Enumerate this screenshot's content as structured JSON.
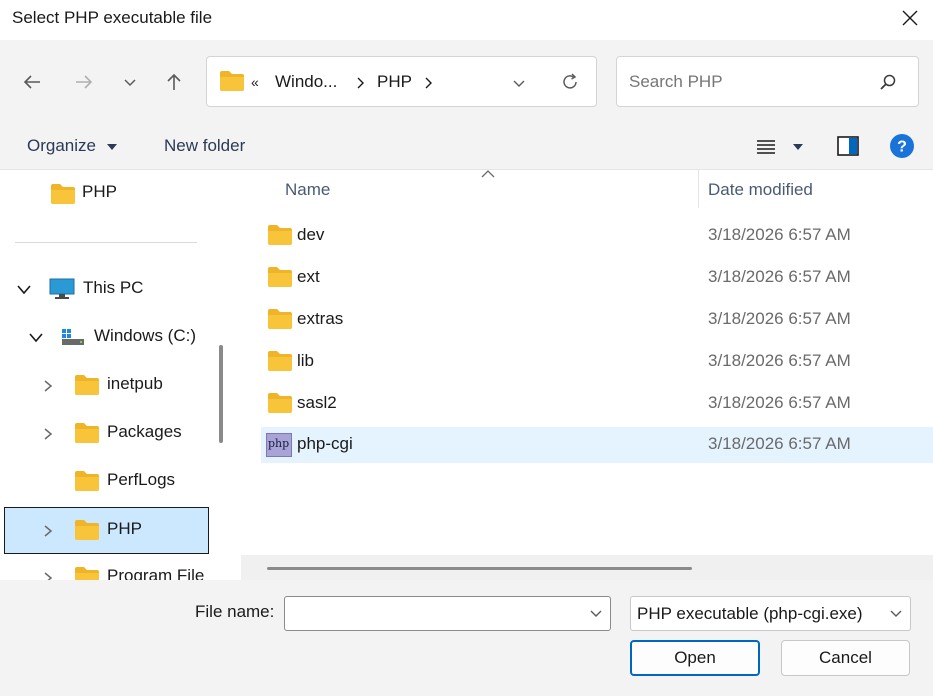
{
  "window": {
    "title": "Select PHP executable file"
  },
  "address": {
    "overflow": "«",
    "crumbs": [
      "Windo...",
      "PHP"
    ]
  },
  "search": {
    "placeholder": "Search PHP"
  },
  "toolbar": {
    "organize_label": "Organize",
    "new_folder_label": "New folder"
  },
  "sidebar": {
    "items": [
      {
        "label": "PHP"
      },
      {
        "label": "This PC"
      },
      {
        "label": "Windows (C:)"
      },
      {
        "label": "inetpub"
      },
      {
        "label": "Packages"
      },
      {
        "label": "PerfLogs"
      },
      {
        "label": "PHP"
      },
      {
        "label": "Program File"
      }
    ]
  },
  "columns": {
    "name": "Name",
    "date_modified": "Date modified"
  },
  "files": [
    {
      "name": "dev",
      "date": "3/18/2026 6:57 AM",
      "icon": "folder-icon"
    },
    {
      "name": "ext",
      "date": "3/18/2026 6:57 AM",
      "icon": "folder-icon"
    },
    {
      "name": "extras",
      "date": "3/18/2026 6:57 AM",
      "icon": "folder-icon"
    },
    {
      "name": "lib",
      "date": "3/18/2026 6:57 AM",
      "icon": "folder-icon"
    },
    {
      "name": "sasl2",
      "date": "3/18/2026 6:57 AM",
      "icon": "folder-icon"
    },
    {
      "name": "php-cgi",
      "date": "3/18/2026 6:57 AM",
      "icon": "php-file-icon",
      "icon_text": "php"
    }
  ],
  "footer": {
    "file_name_label": "File name:",
    "file_name_value": "",
    "file_type": "PHP executable (php-cgi.exe)",
    "open_label": "Open",
    "cancel_label": "Cancel"
  },
  "colors": {
    "accent": "#0067c0",
    "folder": "#f8c53a",
    "selection": "#cce8ff",
    "hover": "#e5f3ff"
  }
}
